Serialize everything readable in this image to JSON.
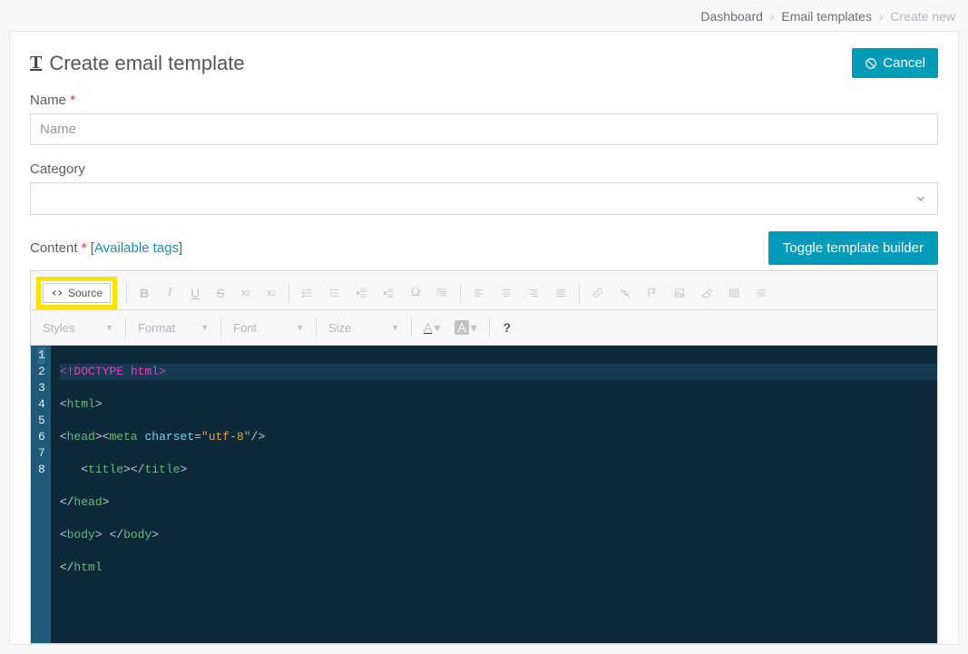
{
  "breadcrumb": {
    "dashboard": "Dashboard",
    "templates": "Email templates",
    "current": "Create new"
  },
  "header": {
    "title": "Create email template",
    "cancel": "Cancel"
  },
  "name_field": {
    "label": "Name",
    "required": "*",
    "placeholder": "Name",
    "value": ""
  },
  "category_field": {
    "label": "Category",
    "value": ""
  },
  "content_field": {
    "label": "Content",
    "required": "*",
    "tags_link": "Available tags",
    "toggle_button": "Toggle template builder"
  },
  "toolbar": {
    "source": "Source",
    "styles": "Styles",
    "format": "Format",
    "font": "Font",
    "size": "Size",
    "help": "?"
  },
  "code": {
    "line1": "<!DOCTYPE html>",
    "line2_tag": "html",
    "line3_head": "head",
    "line3_meta": "meta",
    "line3_attr": "charset",
    "line3_val": "\"utf-8\"",
    "line4_title": "title",
    "line5_head_close": "head",
    "line6_body": "body",
    "line7_html_close": "html",
    "line_numbers": [
      "1",
      "2",
      "3",
      "4",
      "5",
      "6",
      "7",
      "8"
    ]
  }
}
